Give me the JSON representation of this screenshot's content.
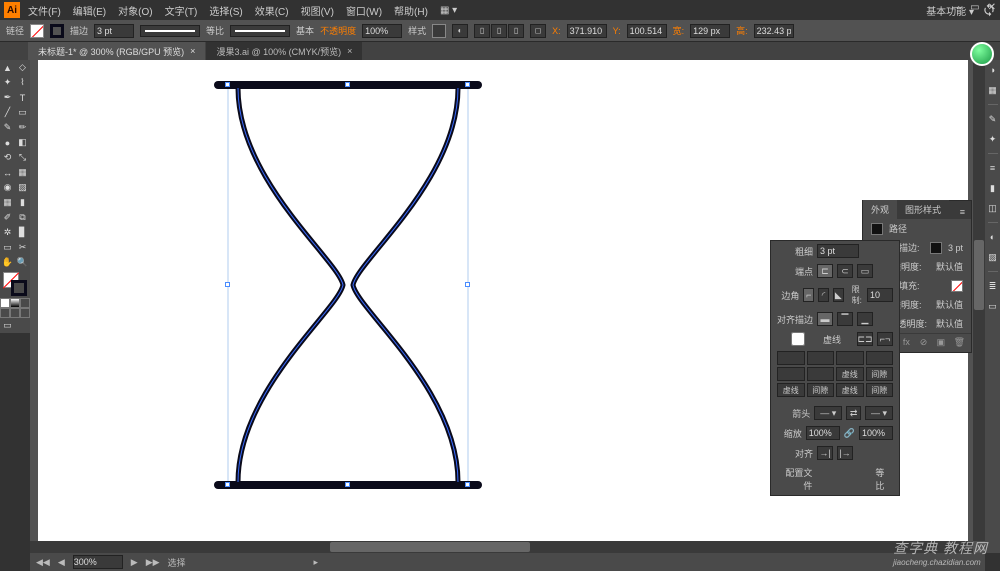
{
  "menu": {
    "items": [
      "文件(F)",
      "编辑(E)",
      "对象(O)",
      "文字(T)",
      "选择(S)",
      "效果(C)",
      "视图(V)",
      "窗口(W)",
      "帮助(H)"
    ],
    "app_abbrev": "Ai",
    "essentials_label": "基本功能 ▾"
  },
  "window_controls": {
    "min": "—",
    "max": "▭",
    "close": "✕"
  },
  "controlbar": {
    "mode_label": "链径",
    "stroke_label": "描边",
    "stroke_weight": "3 pt",
    "variable_width": "等比",
    "brush_label": "基本",
    "opacity_label": "不透明度",
    "opacity": "100%",
    "style_label": "样式",
    "x_label": "X:",
    "x_value": "371.910 p",
    "y_label": "Y:",
    "y_value": "100.514 p",
    "w_label": "宽:",
    "w_value": "129 px",
    "h_label": "高:",
    "h_value": "232.43 px"
  },
  "tabs": [
    {
      "label": "未标题-1* @ 300% (RGB/GPU 预览)",
      "active": true
    },
    {
      "label": "漫果3.ai @ 100% (CMYK/预览)",
      "active": false
    }
  ],
  "statusbar": {
    "zoom": "300%",
    "tool_label": "选择"
  },
  "stroke_panel": {
    "tabs": [
      "外观",
      "图形样式"
    ],
    "weight_label": "粗细",
    "weight": "3 pt",
    "cap_label": "端点",
    "corner_label": "边角",
    "miter_limit": "10",
    "align_label": "对齐描边",
    "dash_label": "虚线",
    "dash_headers": [
      "虚线",
      "间隙",
      "虚线",
      "间隙",
      "虚线",
      "间隙"
    ],
    "arrow_label": "箭头",
    "scale_label": "缩放",
    "scale_a": "100%",
    "scale_b": "100%",
    "align_arrow_label": "对齐",
    "profile_label": "配置文件",
    "profile_value": "等比"
  },
  "appearance_panel": {
    "title": "路径",
    "stroke_label": "描边:",
    "stroke_weight": "3 pt",
    "opacity_label": "不透明度:",
    "opacity_value": "默认值",
    "fill_label": "填充:",
    "fill_opacity_label": "不透明度:",
    "fill_opacity_value": "默认值",
    "obj_opacity_label": "不透明度:",
    "obj_opacity_value": "默认值"
  },
  "watermark": {
    "main": "查字典 教程网",
    "sub": "jiaocheng.chazidian.com"
  }
}
